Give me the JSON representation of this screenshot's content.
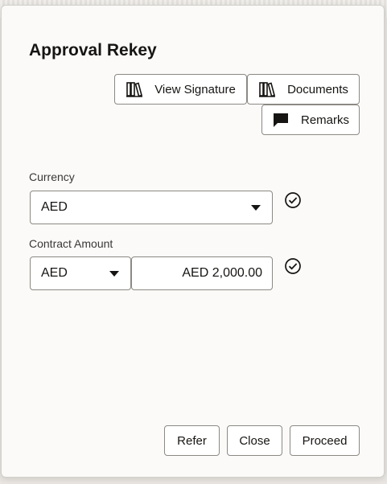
{
  "dialog": {
    "title": "Approval Rekey"
  },
  "toolbar": {
    "view_signature_label": "View Signature",
    "documents_label": "Documents",
    "remarks_label": "Remarks"
  },
  "fields": {
    "currency": {
      "label": "Currency",
      "value": "AED"
    },
    "contract_amount": {
      "label": "Contract Amount",
      "currency_value": "AED",
      "amount_value": "AED 2,000.00"
    }
  },
  "footer": {
    "refer_label": "Refer",
    "close_label": "Close",
    "proceed_label": "Proceed"
  },
  "icons": {
    "view_signature": "books-icon",
    "documents": "books-icon",
    "remarks": "speech-bubble-icon",
    "validated": "check-circle-icon"
  }
}
